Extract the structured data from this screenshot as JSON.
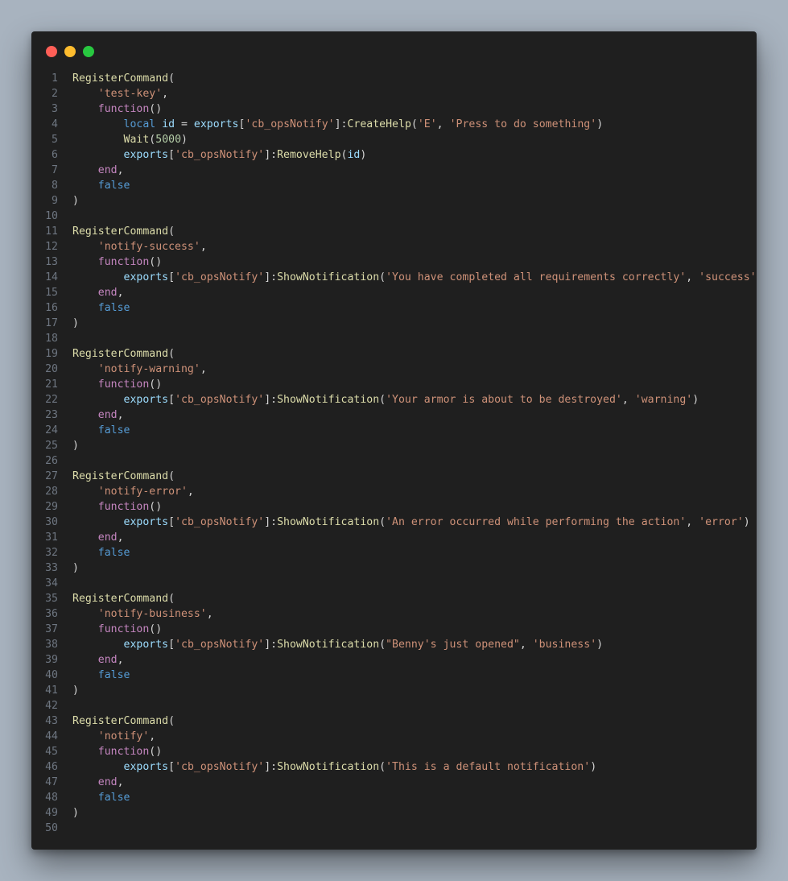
{
  "window": {
    "buttons": [
      "close",
      "minimize",
      "maximize"
    ]
  },
  "colors": {
    "background": "#a8b3bf",
    "editor_bg": "#1f1f1f",
    "function": "#dcdcaa",
    "string": "#ce9178",
    "keyword": "#c586c0",
    "boolean": "#569cd6",
    "variable": "#9cdcfe",
    "number": "#b5cea8",
    "plain": "#d4d4d4",
    "line_number": "#6e7681"
  },
  "lines": [
    [
      [
        "fn",
        "RegisterCommand"
      ],
      [
        "pl",
        "("
      ]
    ],
    [
      [
        "pl",
        "    "
      ],
      [
        "str",
        "'test-key'"
      ],
      [
        "pl",
        ","
      ]
    ],
    [
      [
        "pl",
        "    "
      ],
      [
        "kw",
        "function"
      ],
      [
        "pl",
        "()"
      ]
    ],
    [
      [
        "pl",
        "        "
      ],
      [
        "kwb",
        "local"
      ],
      [
        "pl",
        " "
      ],
      [
        "var",
        "id"
      ],
      [
        "pl",
        " = "
      ],
      [
        "var",
        "exports"
      ],
      [
        "pl",
        "["
      ],
      [
        "str",
        "'cb_opsNotify'"
      ],
      [
        "pl",
        "]:"
      ],
      [
        "fn",
        "CreateHelp"
      ],
      [
        "pl",
        "("
      ],
      [
        "str",
        "'E'"
      ],
      [
        "pl",
        ", "
      ],
      [
        "str",
        "'Press to do something'"
      ],
      [
        "pl",
        ")"
      ]
    ],
    [
      [
        "pl",
        "        "
      ],
      [
        "fn",
        "Wait"
      ],
      [
        "pl",
        "("
      ],
      [
        "num",
        "5000"
      ],
      [
        "pl",
        ")"
      ]
    ],
    [
      [
        "pl",
        "        "
      ],
      [
        "var",
        "exports"
      ],
      [
        "pl",
        "["
      ],
      [
        "str",
        "'cb_opsNotify'"
      ],
      [
        "pl",
        "]:"
      ],
      [
        "fn",
        "RemoveHelp"
      ],
      [
        "pl",
        "("
      ],
      [
        "var",
        "id"
      ],
      [
        "pl",
        ")"
      ]
    ],
    [
      [
        "pl",
        "    "
      ],
      [
        "kw",
        "end"
      ],
      [
        "pl",
        ","
      ]
    ],
    [
      [
        "pl",
        "    "
      ],
      [
        "kwb",
        "false"
      ]
    ],
    [
      [
        "pl",
        ")"
      ]
    ],
    [],
    [
      [
        "fn",
        "RegisterCommand"
      ],
      [
        "pl",
        "("
      ]
    ],
    [
      [
        "pl",
        "    "
      ],
      [
        "str",
        "'notify-success'"
      ],
      [
        "pl",
        ","
      ]
    ],
    [
      [
        "pl",
        "    "
      ],
      [
        "kw",
        "function"
      ],
      [
        "pl",
        "()"
      ]
    ],
    [
      [
        "pl",
        "        "
      ],
      [
        "var",
        "exports"
      ],
      [
        "pl",
        "["
      ],
      [
        "str",
        "'cb_opsNotify'"
      ],
      [
        "pl",
        "]:"
      ],
      [
        "fn",
        "ShowNotification"
      ],
      [
        "pl",
        "("
      ],
      [
        "str",
        "'You have completed all requirements correctly'"
      ],
      [
        "pl",
        ", "
      ],
      [
        "str",
        "'success'"
      ],
      [
        "pl",
        ")"
      ]
    ],
    [
      [
        "pl",
        "    "
      ],
      [
        "kw",
        "end"
      ],
      [
        "pl",
        ","
      ]
    ],
    [
      [
        "pl",
        "    "
      ],
      [
        "kwb",
        "false"
      ]
    ],
    [
      [
        "pl",
        ")"
      ]
    ],
    [],
    [
      [
        "fn",
        "RegisterCommand"
      ],
      [
        "pl",
        "("
      ]
    ],
    [
      [
        "pl",
        "    "
      ],
      [
        "str",
        "'notify-warning'"
      ],
      [
        "pl",
        ","
      ]
    ],
    [
      [
        "pl",
        "    "
      ],
      [
        "kw",
        "function"
      ],
      [
        "pl",
        "()"
      ]
    ],
    [
      [
        "pl",
        "        "
      ],
      [
        "var",
        "exports"
      ],
      [
        "pl",
        "["
      ],
      [
        "str",
        "'cb_opsNotify'"
      ],
      [
        "pl",
        "]:"
      ],
      [
        "fn",
        "ShowNotification"
      ],
      [
        "pl",
        "("
      ],
      [
        "str",
        "'Your armor is about to be destroyed'"
      ],
      [
        "pl",
        ", "
      ],
      [
        "str",
        "'warning'"
      ],
      [
        "pl",
        ")"
      ]
    ],
    [
      [
        "pl",
        "    "
      ],
      [
        "kw",
        "end"
      ],
      [
        "pl",
        ","
      ]
    ],
    [
      [
        "pl",
        "    "
      ],
      [
        "kwb",
        "false"
      ]
    ],
    [
      [
        "pl",
        ")"
      ]
    ],
    [],
    [
      [
        "fn",
        "RegisterCommand"
      ],
      [
        "pl",
        "("
      ]
    ],
    [
      [
        "pl",
        "    "
      ],
      [
        "str",
        "'notify-error'"
      ],
      [
        "pl",
        ","
      ]
    ],
    [
      [
        "pl",
        "    "
      ],
      [
        "kw",
        "function"
      ],
      [
        "pl",
        "()"
      ]
    ],
    [
      [
        "pl",
        "        "
      ],
      [
        "var",
        "exports"
      ],
      [
        "pl",
        "["
      ],
      [
        "str",
        "'cb_opsNotify'"
      ],
      [
        "pl",
        "]:"
      ],
      [
        "fn",
        "ShowNotification"
      ],
      [
        "pl",
        "("
      ],
      [
        "str",
        "'An error occurred while performing the action'"
      ],
      [
        "pl",
        ", "
      ],
      [
        "str",
        "'error'"
      ],
      [
        "pl",
        ")"
      ]
    ],
    [
      [
        "pl",
        "    "
      ],
      [
        "kw",
        "end"
      ],
      [
        "pl",
        ","
      ]
    ],
    [
      [
        "pl",
        "    "
      ],
      [
        "kwb",
        "false"
      ]
    ],
    [
      [
        "pl",
        ")"
      ]
    ],
    [],
    [
      [
        "fn",
        "RegisterCommand"
      ],
      [
        "pl",
        "("
      ]
    ],
    [
      [
        "pl",
        "    "
      ],
      [
        "str",
        "'notify-business'"
      ],
      [
        "pl",
        ","
      ]
    ],
    [
      [
        "pl",
        "    "
      ],
      [
        "kw",
        "function"
      ],
      [
        "pl",
        "()"
      ]
    ],
    [
      [
        "pl",
        "        "
      ],
      [
        "var",
        "exports"
      ],
      [
        "pl",
        "["
      ],
      [
        "str",
        "'cb_opsNotify'"
      ],
      [
        "pl",
        "]:"
      ],
      [
        "fn",
        "ShowNotification"
      ],
      [
        "pl",
        "("
      ],
      [
        "str",
        "\"Benny's just opened\""
      ],
      [
        "pl",
        ", "
      ],
      [
        "str",
        "'business'"
      ],
      [
        "pl",
        ")"
      ]
    ],
    [
      [
        "pl",
        "    "
      ],
      [
        "kw",
        "end"
      ],
      [
        "pl",
        ","
      ]
    ],
    [
      [
        "pl",
        "    "
      ],
      [
        "kwb",
        "false"
      ]
    ],
    [
      [
        "pl",
        ")"
      ]
    ],
    [],
    [
      [
        "fn",
        "RegisterCommand"
      ],
      [
        "pl",
        "("
      ]
    ],
    [
      [
        "pl",
        "    "
      ],
      [
        "str",
        "'notify'"
      ],
      [
        "pl",
        ","
      ]
    ],
    [
      [
        "pl",
        "    "
      ],
      [
        "kw",
        "function"
      ],
      [
        "pl",
        "()"
      ]
    ],
    [
      [
        "pl",
        "        "
      ],
      [
        "var",
        "exports"
      ],
      [
        "pl",
        "["
      ],
      [
        "str",
        "'cb_opsNotify'"
      ],
      [
        "pl",
        "]:"
      ],
      [
        "fn",
        "ShowNotification"
      ],
      [
        "pl",
        "("
      ],
      [
        "str",
        "'This is a default notification'"
      ],
      [
        "pl",
        ")"
      ]
    ],
    [
      [
        "pl",
        "    "
      ],
      [
        "kw",
        "end"
      ],
      [
        "pl",
        ","
      ]
    ],
    [
      [
        "pl",
        "    "
      ],
      [
        "kwb",
        "false"
      ]
    ],
    [
      [
        "pl",
        ")"
      ]
    ],
    []
  ]
}
